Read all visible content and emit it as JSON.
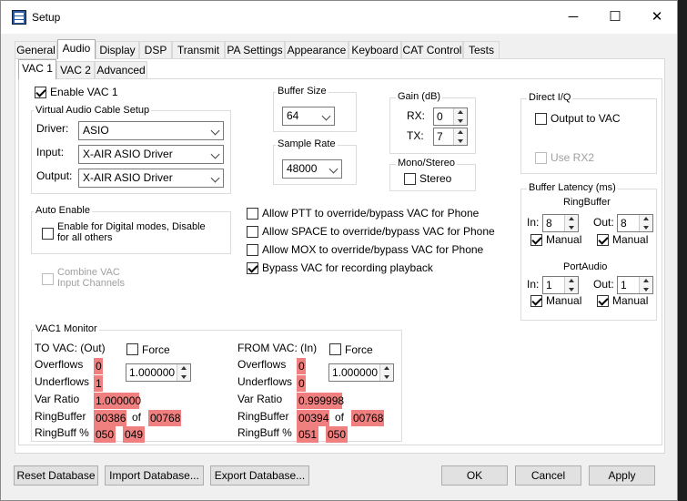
{
  "window": {
    "title": "Setup",
    "icon": "app-icon"
  },
  "title_controls": {
    "minimize": "─",
    "maximize": "☐",
    "close": "✕"
  },
  "tabs": [
    "General",
    "Audio",
    "Display",
    "DSP",
    "Transmit",
    "PA Settings",
    "Appearance",
    "Keyboard",
    "CAT Control",
    "Tests"
  ],
  "subtabs": [
    "VAC 1",
    "VAC 2",
    "Advanced"
  ],
  "enable_vac1": "Enable VAC 1",
  "vac_setup": {
    "title": "Virtual Audio Cable Setup",
    "driver_label": "Driver:",
    "driver_value": "ASIO",
    "input_label": "Input:",
    "input_value": "X-AIR ASIO Driver",
    "output_label": "Output:",
    "output_value": "X-AIR ASIO Driver"
  },
  "buffer_size": {
    "title": "Buffer Size",
    "value": "64"
  },
  "sample_rate": {
    "title": "Sample Rate",
    "value": "48000"
  },
  "gain": {
    "title": "Gain (dB)",
    "rx_label": "RX:",
    "rx_value": "0",
    "tx_label": "TX:",
    "tx_value": "7"
  },
  "mono_stereo": {
    "title": "Mono/Stereo",
    "stereo": "Stereo"
  },
  "direct_iq": {
    "title": "Direct I/Q",
    "output_to_vac": "Output to VAC",
    "use_rx2": "Use RX2"
  },
  "auto_enable": {
    "title": "Auto Enable",
    "line1": "Enable for Digital modes, Disable",
    "line2": "for all others"
  },
  "combine_vac": {
    "line1": "Combine VAC",
    "line2": "Input Channels"
  },
  "overrides": [
    {
      "label": "Allow PTT to override/bypass VAC for Phone",
      "checked": false
    },
    {
      "label": "Allow SPACE to override/bypass VAC for Phone",
      "checked": false
    },
    {
      "label": "Allow MOX to override/bypass VAC for Phone",
      "checked": false
    },
    {
      "label": "Bypass VAC for recording playback",
      "checked": true
    }
  ],
  "buffer_latency": {
    "title": "Buffer Latency (ms)",
    "ringbuffer": "RingBuffer",
    "portaudio": "PortAudio",
    "in_label": "In:",
    "out_label": "Out:",
    "manual": "Manual",
    "rb_in": "8",
    "rb_out": "8",
    "pa_in": "1",
    "pa_out": "1"
  },
  "monitor": {
    "title": "VAC1 Monitor",
    "force": "Force",
    "overflows": "Overflows",
    "underflows": "Underflows",
    "var_ratio": "Var Ratio",
    "ringbuffer": "RingBuffer",
    "ringbuff_pct": "RingBuff %",
    "of": "of",
    "to": {
      "title": "TO VAC: (Out)",
      "spin": "1.000000",
      "overflows": "0",
      "underflows": "1",
      "var_ratio": "1.000000",
      "rb_a": "00386",
      "rb_b": "00768",
      "pct_a": "050",
      "pct_b": "049"
    },
    "from": {
      "title": "FROM VAC: (In)",
      "spin": "1.000000",
      "overflows": "0",
      "underflows": "0",
      "var_ratio": "0.999998",
      "rb_a": "00394",
      "rb_b": "00768",
      "pct_a": "051",
      "pct_b": "050"
    }
  },
  "buttons": {
    "reset": "Reset Database",
    "import": "Import Database...",
    "export": "Export Database...",
    "ok": "OK",
    "cancel": "Cancel",
    "apply": "Apply"
  }
}
